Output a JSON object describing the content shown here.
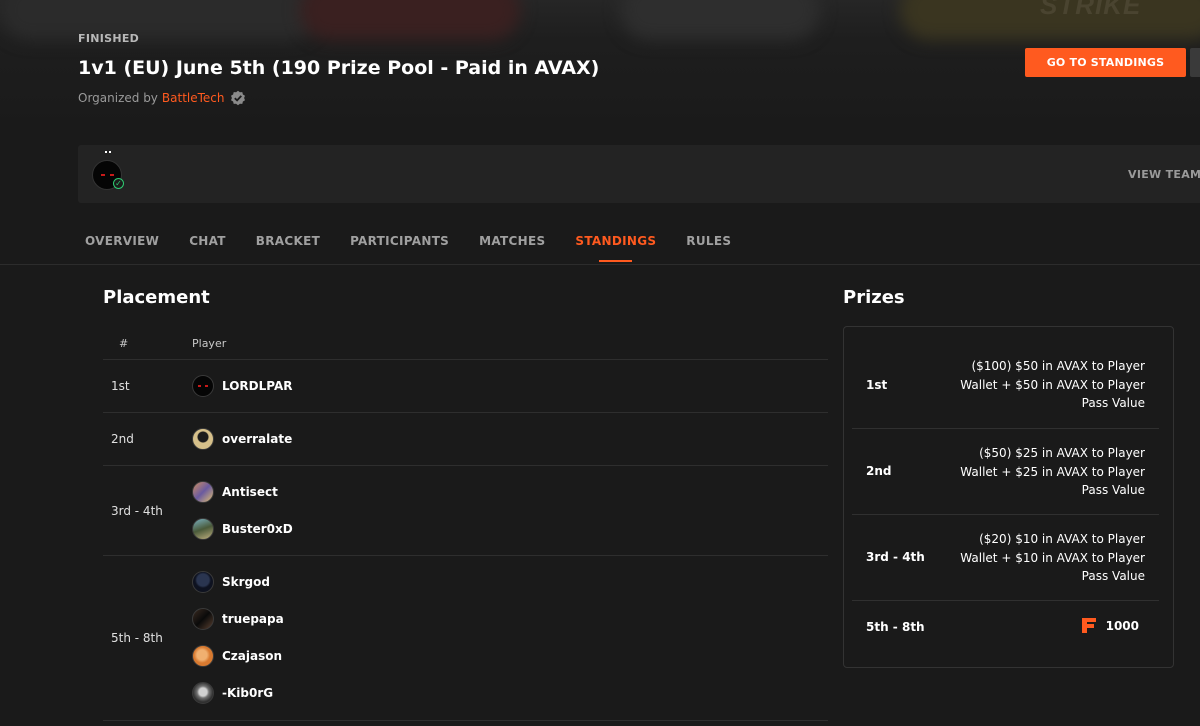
{
  "tournament": {
    "status": "FINISHED",
    "title": "1v1 (EU) June 5th (190 Prize Pool - Paid in AVAX)",
    "organized_by_label": "Organized by",
    "organizer": "BattleTech",
    "go_to_standings_label": "GO TO STANDINGS",
    "banner_watermark": "STRIKE"
  },
  "team_bar": {
    "view_team_label": "VIEW TEAM"
  },
  "tabs": [
    {
      "label": "OVERVIEW",
      "active": false
    },
    {
      "label": "CHAT",
      "active": false
    },
    {
      "label": "BRACKET",
      "active": false
    },
    {
      "label": "PARTICIPANTS",
      "active": false
    },
    {
      "label": "MATCHES",
      "active": false
    },
    {
      "label": "STANDINGS",
      "active": true
    },
    {
      "label": "RULES",
      "active": false
    }
  ],
  "placement": {
    "title": "Placement",
    "columns": {
      "rank": "#",
      "player": "Player"
    },
    "rows": [
      {
        "rank": "1st",
        "players": [
          "LORDLPAR"
        ]
      },
      {
        "rank": "2nd",
        "players": [
          "overralate"
        ]
      },
      {
        "rank": "3rd - 4th",
        "players": [
          "Antisect",
          "Buster0xD"
        ]
      },
      {
        "rank": "5th - 8th",
        "players": [
          "Skrgod",
          "truepapa",
          "Czajason",
          "-Kib0rG"
        ]
      }
    ]
  },
  "prizes": {
    "title": "Prizes",
    "rows": [
      {
        "place": "1st",
        "prize": "($100) $50 in AVAX to Player Wallet + $50 in AVAX to Player Pass Value"
      },
      {
        "place": "2nd",
        "prize": "($50) $25 in AVAX to Player Wallet + $25 in AVAX to Player Pass Value"
      },
      {
        "place": "3rd - 4th",
        "prize": "($20) $10 in AVAX to Player Wallet + $10 in AVAX to Player Pass Value"
      },
      {
        "place": "5th - 8th",
        "credits": "1000",
        "credits_icon": "f-credits-icon"
      }
    ]
  },
  "colors": {
    "accent": "#ff5a1f",
    "background": "#1a1a1a",
    "panel": "#232323",
    "verified_green": "#2ecc71"
  }
}
